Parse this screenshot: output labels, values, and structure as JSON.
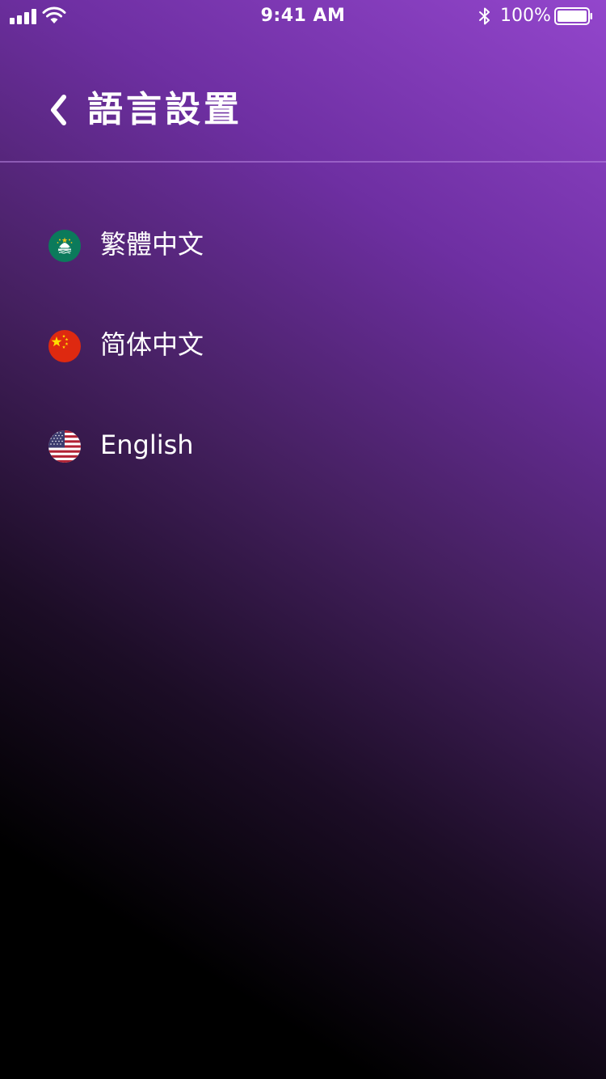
{
  "status_bar": {
    "time": "9:41 AM",
    "battery_percent": "100%",
    "battery_level": 1.0,
    "icons": [
      "signal-icon",
      "wifi-icon",
      "bluetooth-icon",
      "battery-icon"
    ]
  },
  "header": {
    "title": "語言設置",
    "back_icon": "chevron-left-icon"
  },
  "languages": [
    {
      "label": "繁體中文",
      "flag_icon": "macau-flag-icon"
    },
    {
      "label": "简体中文",
      "flag_icon": "china-flag-icon"
    },
    {
      "label": "English",
      "flag_icon": "usa-flag-icon"
    }
  ],
  "colors": {
    "background_top": "#9346cc",
    "background_mid": "#452060",
    "background_bottom": "#000000",
    "text": "#ffffff",
    "divider": "#8a5cb0"
  }
}
